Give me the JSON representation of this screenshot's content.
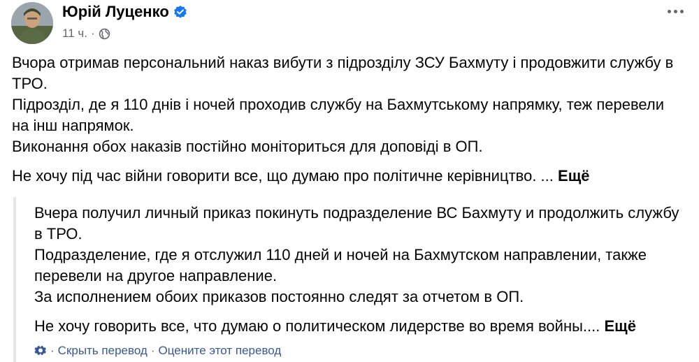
{
  "author": {
    "name": "Юрій Луценко",
    "avatar_icon": "user-photo",
    "verified_icon": "verified-badge-icon",
    "verified_color": "#1877f2"
  },
  "meta": {
    "time": "11 ч.",
    "separator": "·",
    "privacy_icon": "globe-icon"
  },
  "menu": {
    "icon": "more-options-icon"
  },
  "post": {
    "lines": [
      "Вчора отримав персональний наказ вибути з підрозділу ЗСУ Бахмуту і продовжити службу в ТРО.",
      "Підрозділ, де я 110 днів і ночей проходив службу на Бахмутському напрямку, теж перевели на інш напрямок.",
      "Виконання обох наказів постійно моніториться для доповіді в ОП."
    ],
    "last_line": "Не хочу під час війни говорити все, що думаю про політичне керівництво. ...",
    "see_more": "Ещё"
  },
  "translation": {
    "lines": [
      "Вчера получил личный приказ покинуть подразделение ВС Бахмуту и продолжить службу в ТРО.",
      "Подразделение, где я отслужил 110 дней и ночей на Бахмутском направлении, также перевели на другое направление.",
      "За исполнением обоих приказов постоянно следят за отчетом в ОП."
    ],
    "last_line": "Не хочу говорить все, что думаю о политическом лидерстве во время войны....",
    "see_more": "Ещё",
    "footer": {
      "settings_icon": "gear-icon",
      "separator": "·",
      "hide_translation": "Скрыть перевод",
      "rate_translation": "Оцените этот перевод"
    }
  },
  "colors": {
    "text": "#050505",
    "secondary": "#65676b",
    "link": "#385898",
    "border": "#e4e6eb"
  }
}
